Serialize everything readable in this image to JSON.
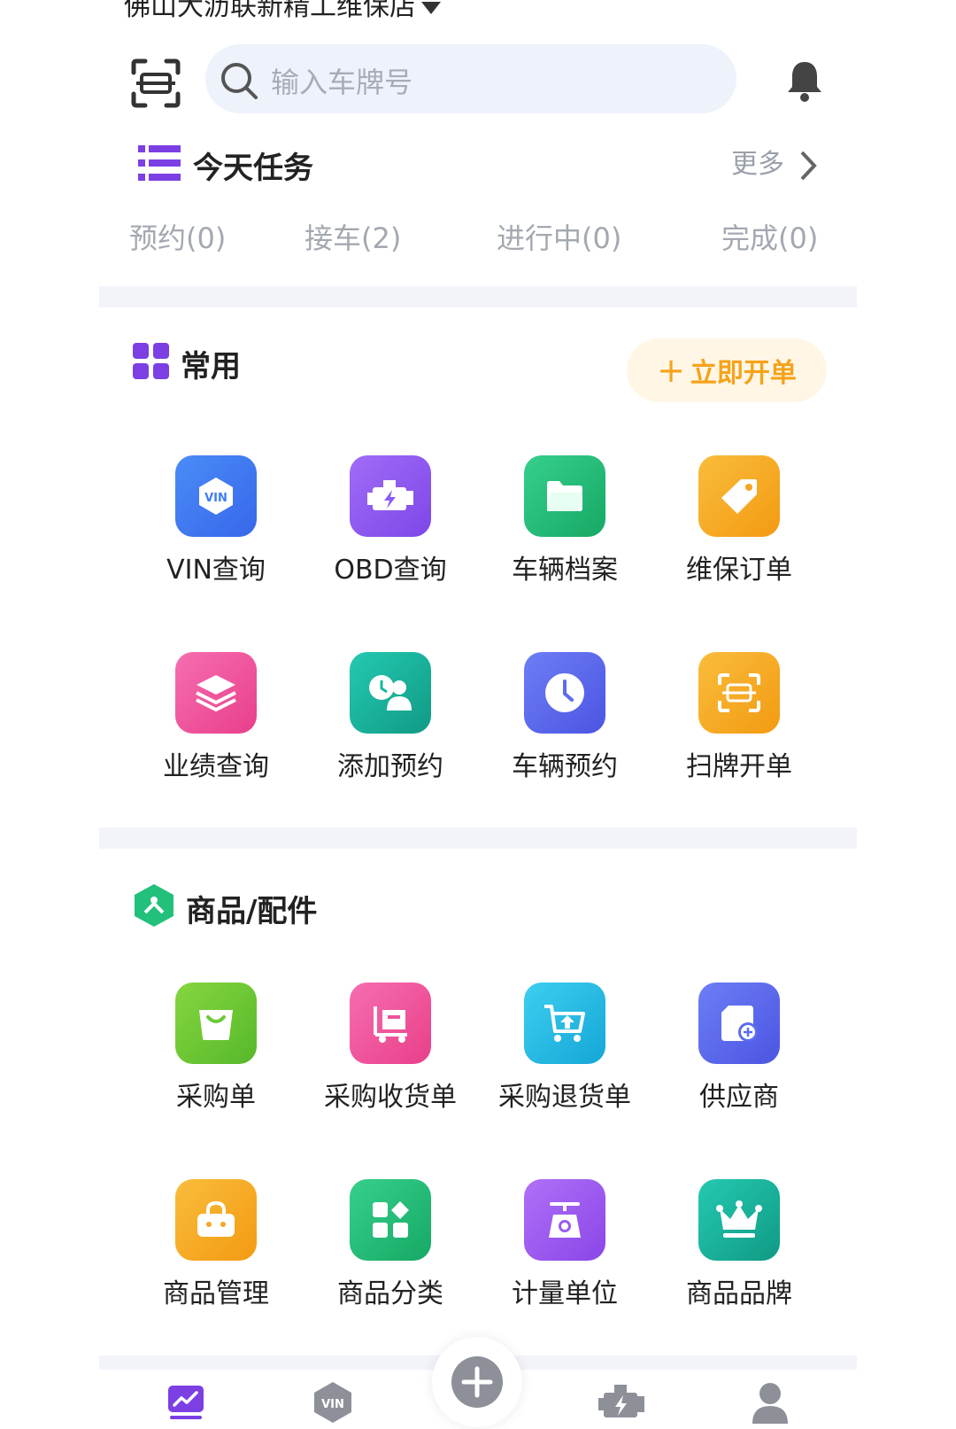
{
  "header": {
    "shop_name": "佛山大沥联新精工维保店",
    "search_placeholder": "输入车牌号"
  },
  "tasks": {
    "title": "今天任务",
    "more_label": "更多",
    "tabs": [
      {
        "label": "预约(0)"
      },
      {
        "label": "接车(2)"
      },
      {
        "label": "进行中(0)"
      },
      {
        "label": "完成(0)"
      }
    ]
  },
  "common": {
    "title": "常用",
    "open_order_label": "立即开单",
    "items": [
      {
        "label": "VIN查询",
        "icon": "vin-icon",
        "color": "#3f7df3"
      },
      {
        "label": "OBD查询",
        "icon": "engine-icon",
        "color": "#8b5cf6"
      },
      {
        "label": "车辆档案",
        "icon": "folder-icon",
        "color": "#22c07a"
      },
      {
        "label": "维保订单",
        "icon": "tag-icon",
        "color": "#f5a623"
      },
      {
        "label": "业绩查询",
        "icon": "layers-icon",
        "color": "#f0529c"
      },
      {
        "label": "添加预约",
        "icon": "user-clock-icon",
        "color": "#17b8a0"
      },
      {
        "label": "车辆预约",
        "icon": "clock-icon",
        "color": "#5b6cf0"
      },
      {
        "label": "扫牌开单",
        "icon": "scan-icon",
        "color": "#f5a623"
      }
    ]
  },
  "goods": {
    "title": "商品/配件",
    "items": [
      {
        "label": "采购单",
        "icon": "shopping-bag-icon",
        "color": "#6cc93a"
      },
      {
        "label": "采购收货单",
        "icon": "cart-receive-icon",
        "color": "#f0529c"
      },
      {
        "label": "采购退货单",
        "icon": "cart-return-icon",
        "color": "#1fb8e0"
      },
      {
        "label": "供应商",
        "icon": "supplier-icon",
        "color": "#5b6cf0"
      },
      {
        "label": "商品管理",
        "icon": "basket-icon",
        "color": "#f5a623"
      },
      {
        "label": "商品分类",
        "icon": "category-icon",
        "color": "#22c07a"
      },
      {
        "label": "计量单位",
        "icon": "scale-icon",
        "color": "#9b5cf0"
      },
      {
        "label": "商品品牌",
        "icon": "crown-icon",
        "color": "#17b8a0"
      }
    ]
  },
  "bottom_nav": {
    "vin_text": "VIN",
    "items": [
      "dashboard-icon",
      "vin-icon",
      "add-icon",
      "engine-icon",
      "profile-icon"
    ]
  },
  "colors": {
    "accent_purple": "#7b3fe4",
    "accent_orange": "#f5a31a",
    "accent_green": "#22c07a"
  }
}
